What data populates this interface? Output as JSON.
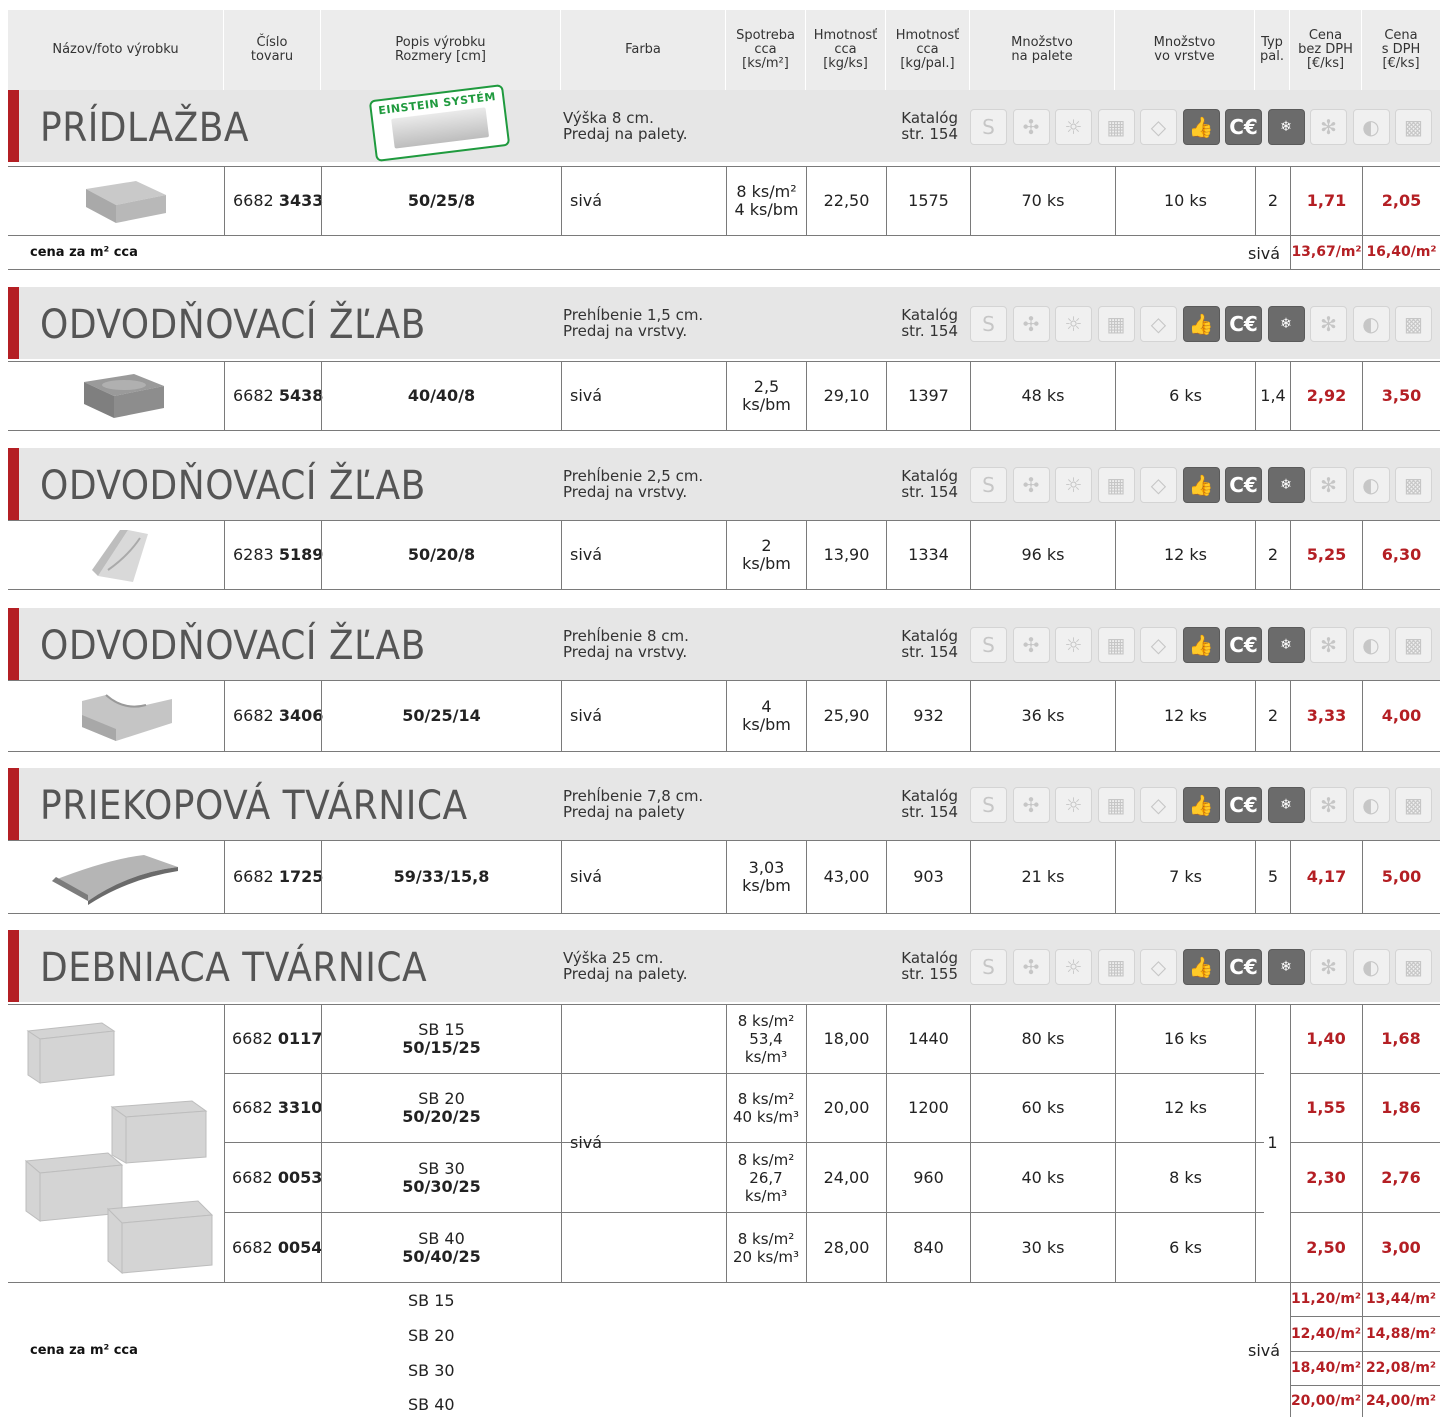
{
  "header": {
    "name_photo": "Názov/foto výrobku",
    "item_number": "Číslo\ntovaru",
    "description": "Popis výrobku\nRozmery [cm]",
    "color": "Farba",
    "consumption": "Spotreba\ncca\n[ks/m²]",
    "weight_piece": "Hmotnosť\ncca\n[kg/ks]",
    "weight_pallet": "Hmotnosť\ncca\n[kg/pal.]",
    "qty_pallet": "Množstvo\nna palete",
    "qty_layer": "Množstvo\nvo vrstve",
    "pallet_type": "Typ\npal.",
    "price_no_vat": "Cena\nbez DPH\n[€/ks]",
    "price_vat": "Cena\ns DPH\n[€/ks]"
  },
  "badge": "EINSTEIN SYSTÉM",
  "sections": [
    {
      "title": "PRÍDLAŽBA",
      "desc": "Výška 8 cm.\nPredaj na palety.",
      "catalog": "Katalóg\nstr. 154",
      "rows": [
        {
          "code_a": "6682",
          "code_b": "3433",
          "dims": "50/25/8",
          "color": "sivá",
          "consumption": "8 ks/m²\n4 ks/bm",
          "weight": "22,50",
          "pallet_weight": "1575",
          "qty_pallet": "70 ks",
          "qty_layer": "10 ks",
          "pallet_type": "2",
          "price": "1,71",
          "price_vat": "2,05"
        }
      ],
      "summary": {
        "label": "cena za m² cca",
        "color": "sivá",
        "price": "13,67/m²",
        "price_vat": "16,40/m²"
      }
    },
    {
      "title": "ODVODŇOVACÍ ŽĽAB",
      "desc": "Prehĺbenie 1,5 cm.\nPredaj na vrstvy.",
      "catalog": "Katalóg\nstr. 154",
      "rows": [
        {
          "code_a": "6682",
          "code_b": "5438",
          "dims": "40/40/8",
          "color": "sivá",
          "consumption": "2,5\nks/bm",
          "weight": "29,10",
          "pallet_weight": "1397",
          "qty_pallet": "48 ks",
          "qty_layer": "6 ks",
          "pallet_type": "1,4",
          "price": "2,92",
          "price_vat": "3,50"
        }
      ]
    },
    {
      "title": "ODVODŇOVACÍ ŽĽAB",
      "desc": "Prehĺbenie 2,5 cm.\nPredaj na vrstvy.",
      "catalog": "Katalóg\nstr. 154",
      "rows": [
        {
          "code_a": "6283",
          "code_b": "5189",
          "dims": "50/20/8",
          "color": "sivá",
          "consumption": "2\nks/bm",
          "weight": "13,90",
          "pallet_weight": "1334",
          "qty_pallet": "96 ks",
          "qty_layer": "12 ks",
          "pallet_type": "2",
          "price": "5,25",
          "price_vat": "6,30"
        }
      ]
    },
    {
      "title": "ODVODŇOVACÍ ŽĽAB",
      "desc": "Prehĺbenie 8 cm.\nPredaj na vrstvy.",
      "catalog": "Katalóg\nstr. 154",
      "rows": [
        {
          "code_a": "6682",
          "code_b": "3406",
          "dims": "50/25/14",
          "color": "sivá",
          "consumption": "4\nks/bm",
          "weight": "25,90",
          "pallet_weight": "932",
          "qty_pallet": "36 ks",
          "qty_layer": "12 ks",
          "pallet_type": "2",
          "price": "3,33",
          "price_vat": "4,00"
        }
      ]
    },
    {
      "title": "PRIEKOPOVÁ TVÁRNICA",
      "desc": "Prehĺbenie 7,8 cm.\nPredaj na palety",
      "catalog": "Katalóg\nstr. 154",
      "rows": [
        {
          "code_a": "6682",
          "code_b": "1725",
          "dims": "59/33/15,8",
          "color": "sivá",
          "consumption": "3,03\nks/bm",
          "weight": "43,00",
          "pallet_weight": "903",
          "qty_pallet": "21 ks",
          "qty_layer": "7 ks",
          "pallet_type": "5",
          "price": "4,17",
          "price_vat": "5,00"
        }
      ]
    },
    {
      "title": "DEBNIACA TVÁRNICA",
      "desc": "Výška 25 cm.\nPredaj na palety.",
      "catalog": "Katalóg\nstr. 155",
      "color": "sivá",
      "pallet_type": "1",
      "rows": [
        {
          "code_a": "6682",
          "code_b": "0117",
          "name": "SB 15",
          "dims": "50/15/25",
          "consumption": "8 ks/m²\n53,4\nks/m³",
          "weight": "18,00",
          "pallet_weight": "1440",
          "qty_pallet": "80 ks",
          "qty_layer": "16 ks",
          "price": "1,40",
          "price_vat": "1,68"
        },
        {
          "code_a": "6682",
          "code_b": "3310",
          "name": "SB 20",
          "dims": "50/20/25",
          "consumption": "8 ks/m²\n40 ks/m³",
          "weight": "20,00",
          "pallet_weight": "1200",
          "qty_pallet": "60 ks",
          "qty_layer": "12 ks",
          "price": "1,55",
          "price_vat": "1,86"
        },
        {
          "code_a": "6682",
          "code_b": "0053",
          "name": "SB 30",
          "dims": "50/30/25",
          "consumption": "8 ks/m²\n26,7\nks/m³",
          "weight": "24,00",
          "pallet_weight": "960",
          "qty_pallet": "40 ks",
          "qty_layer": "8 ks",
          "price": "2,30",
          "price_vat": "2,76"
        },
        {
          "code_a": "6682",
          "code_b": "0054",
          "name": "SB 40",
          "dims": "50/40/25",
          "consumption": "8 ks/m²\n20 ks/m³",
          "weight": "28,00",
          "pallet_weight": "840",
          "qty_pallet": "30 ks",
          "qty_layer": "6 ks",
          "price": "2,50",
          "price_vat": "3,00"
        }
      ],
      "summary": {
        "label": "cena za m² cca",
        "color": "sivá",
        "lines": [
          {
            "name": "SB 15",
            "price": "11,20/m²",
            "price_vat": "13,44/m²"
          },
          {
            "name": "SB 20",
            "price": "12,40/m²",
            "price_vat": "14,88/m²"
          },
          {
            "name": "SB 30",
            "price": "18,40/m²",
            "price_vat": "22,08/m²"
          },
          {
            "name": "SB 40",
            "price": "20,00/m²",
            "price_vat": "24,00/m²"
          }
        ]
      }
    }
  ],
  "icon_names": [
    "s-logo-icon",
    "pattern-icon",
    "bulb-icon",
    "brick-icon",
    "diamond-icon",
    "thumbs-up-icon",
    "ce-mark-icon",
    "frost-water-icon",
    "snowflake-icon",
    "drop-icon",
    "texture-icon"
  ],
  "colors": {
    "accent_red": "#b41f24",
    "band_gray": "#e6e6e6",
    "header_gray": "#ececec",
    "icon_dark": "#6b6b6b",
    "badge_green": "#1f9a3e"
  }
}
